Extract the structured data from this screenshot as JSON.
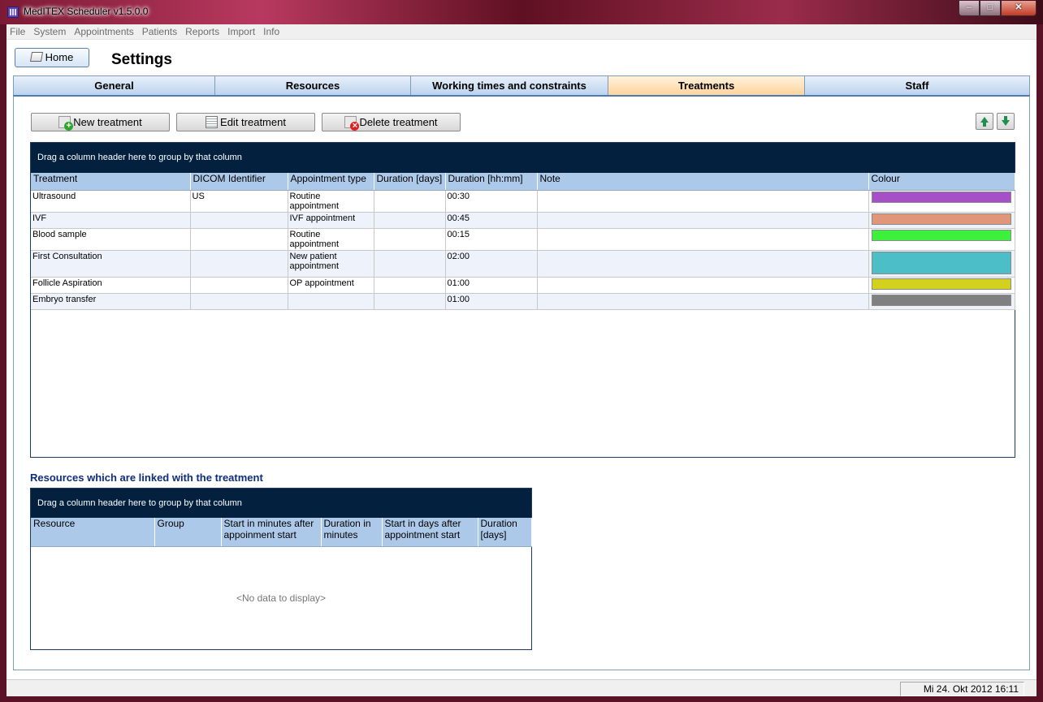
{
  "window": {
    "title": "MedITEX  Scheduler v1.5.0.0",
    "min_glyph": "–",
    "max_glyph": "□",
    "close_glyph": "✕"
  },
  "menu": [
    "File",
    "System",
    "Appointments",
    "Patients",
    "Reports",
    "Import",
    "Info"
  ],
  "home_button": "Home",
  "page_title": "Settings",
  "tabs": [
    {
      "label": "General",
      "active": false
    },
    {
      "label": "Resources",
      "active": false
    },
    {
      "label": "Working times and constraints",
      "active": false
    },
    {
      "label": "Treatments",
      "active": true
    },
    {
      "label": "Staff",
      "active": false
    }
  ],
  "toolbar": {
    "new_label": "New treatment",
    "edit_label": "Edit treatment",
    "delete_label": "Delete treatment"
  },
  "treatments_grid": {
    "group_hint": "Drag a column header here to group by that column",
    "columns": [
      "Treatment",
      "DICOM Identifier",
      "Appointment type",
      "Duration [days]",
      "Duration [hh:mm]",
      "Note",
      "Colour"
    ],
    "rows": [
      {
        "treatment": "Ultrasound",
        "dicom": "US",
        "appt_type": "Routine appointment",
        "days": "",
        "hhmm": "00:30",
        "note": "",
        "colour": "#a550c8"
      },
      {
        "treatment": "IVF",
        "dicom": "",
        "appt_type": "IVF appointment",
        "days": "",
        "hhmm": "00:45",
        "note": "",
        "colour": "#e1967a"
      },
      {
        "treatment": "Blood sample",
        "dicom": "",
        "appt_type": "Routine appointment",
        "days": "",
        "hhmm": "00:15",
        "note": "",
        "colour": "#3cf03c"
      },
      {
        "treatment": "First Consultation",
        "dicom": "",
        "appt_type": "New patient appointment",
        "days": "",
        "hhmm": "02:00",
        "note": "",
        "colour": "#4bbec8"
      },
      {
        "treatment": "Follicle Aspiration",
        "dicom": "",
        "appt_type": "OP appointment",
        "days": "",
        "hhmm": "01:00",
        "note": "",
        "colour": "#d2d21e"
      },
      {
        "treatment": "Embryo transfer",
        "dicom": "",
        "appt_type": "",
        "days": "",
        "hhmm": "01:00",
        "note": "",
        "colour": "#808080"
      }
    ]
  },
  "linked_resources": {
    "label": "Resources which are linked with the treatment",
    "group_hint": "Drag a column header here to group by that column",
    "columns": [
      "Resource",
      "Group",
      "Start in minutes after appoinment start",
      "Duration in minutes",
      "Start in days after appointment start",
      "Duration [days]"
    ],
    "empty_text": "<No data to display>"
  },
  "status": {
    "datetime": "Mi 24. Okt 2012 16:11"
  }
}
